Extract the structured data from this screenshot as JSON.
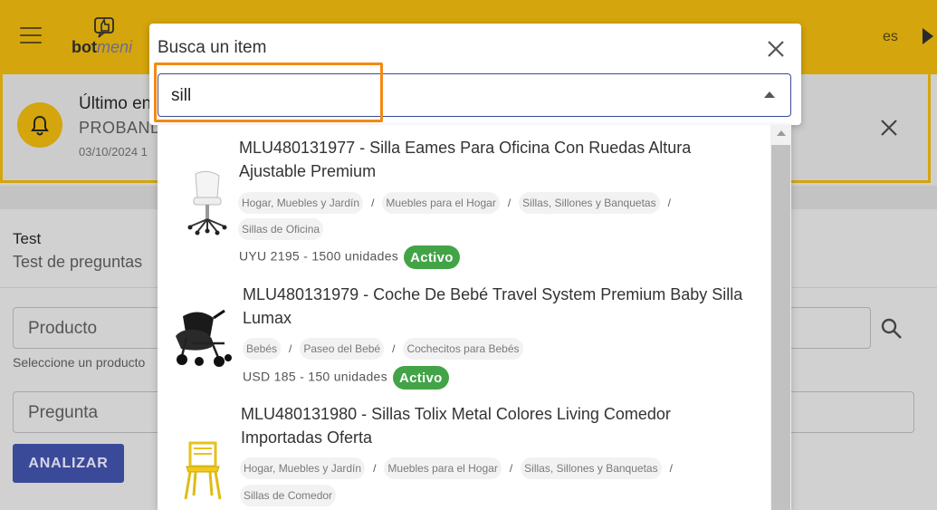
{
  "app": {
    "logo_text": "bot",
    "logo_text_accent": "meni",
    "language": "es"
  },
  "notification": {
    "title": "Último en",
    "subtitle": "PROBAND",
    "date": "03/10/2024 1"
  },
  "panel": {
    "title": "Test",
    "subtitle": "Test de preguntas",
    "product_label": "Producto",
    "product_hint": "Seleccione un producto",
    "question_label": "Pregunta",
    "analyze_label": "ANALIZAR"
  },
  "dialog": {
    "title": "Busca un item",
    "search_value": "sill"
  },
  "results": [
    {
      "title": "MLU480131977 - Silla Eames Para Oficina Con Ruedas Altura Ajustable Premium",
      "breadcrumb_line1": [
        "Hogar, Muebles y Jardín",
        "Muebles para el Hogar",
        "Sillas, Sillones y Banquetas"
      ],
      "breadcrumb_line2": "Sillas de Oficina",
      "price": "UYU 2195 - 1500 unidades",
      "status": "Activo"
    },
    {
      "title": "MLU480131979 - Coche De Bebé Travel System Premium Baby Silla Lumax",
      "breadcrumb_line1": [
        "Bebés",
        "Paseo del Bebé",
        "Cochecitos para Bebés"
      ],
      "price": "USD 185 - 150 unidades",
      "status": "Activo"
    },
    {
      "title": "MLU480131980 - Sillas Tolix Metal Colores Living Comedor Importadas Oferta",
      "breadcrumb_line1": [
        "Hogar, Muebles y Jardín",
        "Muebles para el Hogar",
        "Sillas, Sillones y Banquetas"
      ],
      "breadcrumb_line2": "Sillas de Comedor"
    }
  ],
  "colors": {
    "brand": "#d4a50c",
    "primary": "#3a4a99",
    "active": "#43a347",
    "highlight": "#f28a14"
  },
  "icons": {
    "menu": "hamburger-icon",
    "bell": "bell-icon",
    "close": "close-icon",
    "search": "search-icon",
    "caret": "caret-up-icon"
  }
}
